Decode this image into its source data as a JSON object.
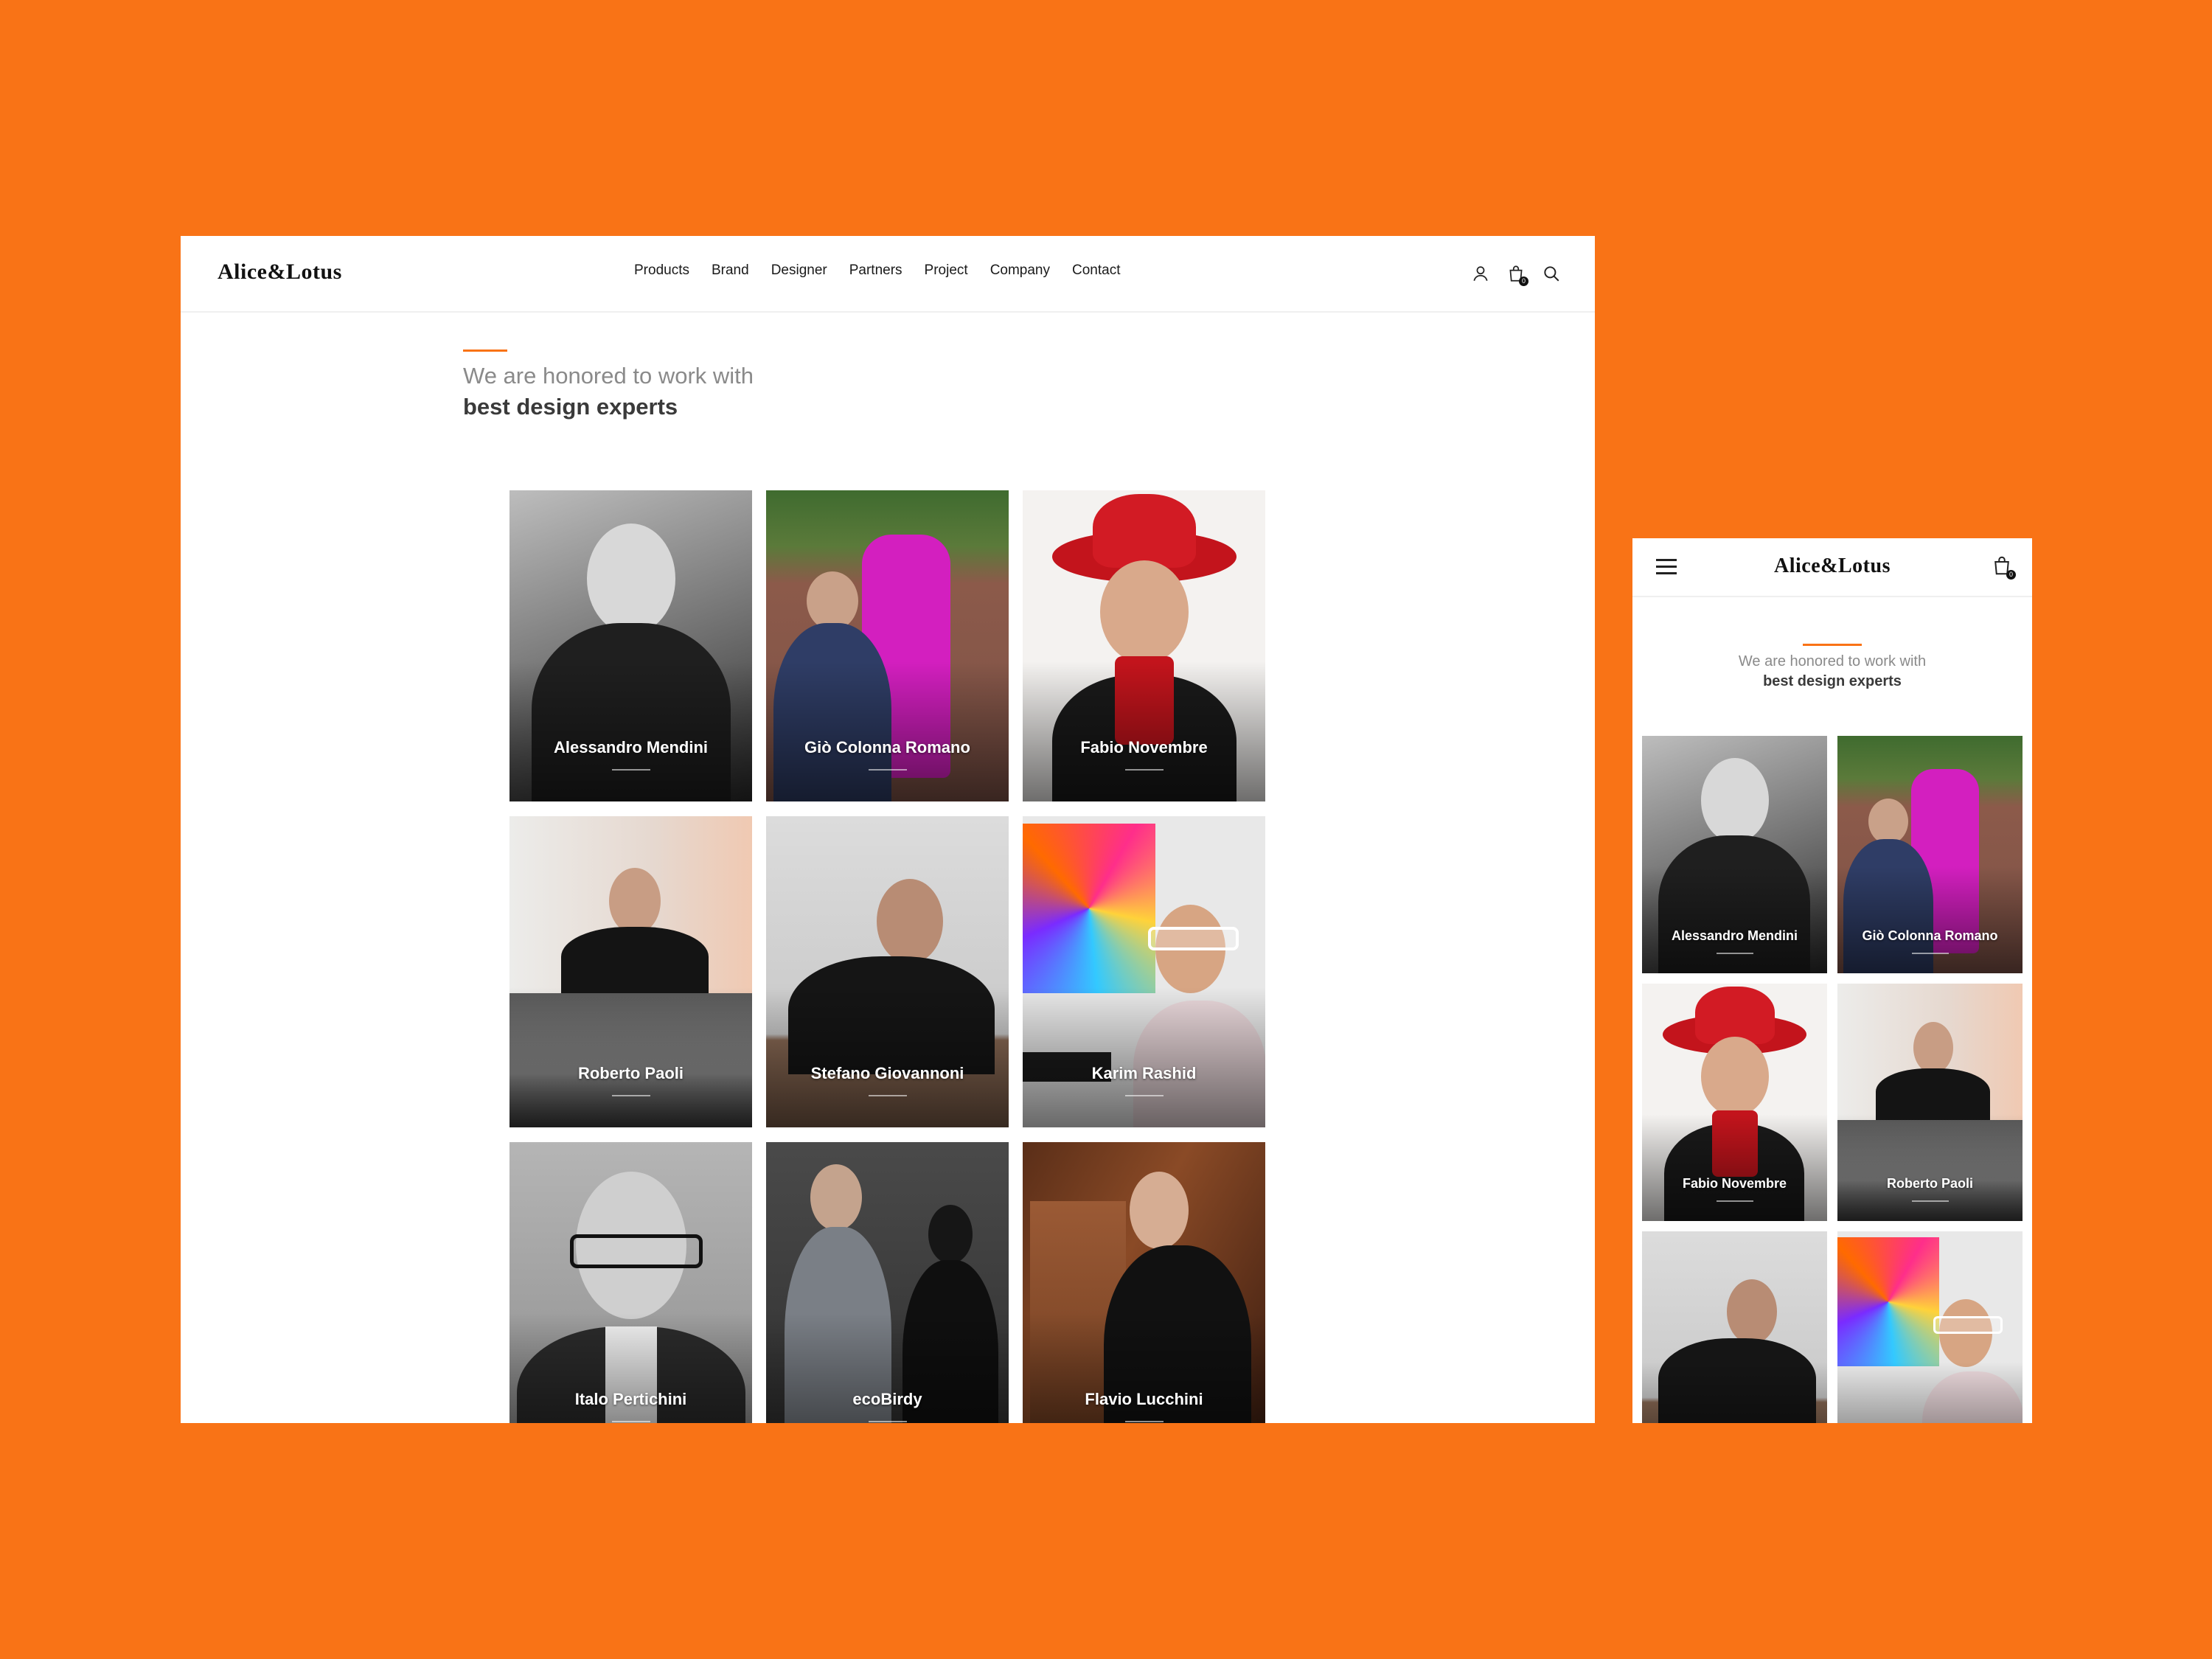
{
  "brand": {
    "name": "Alice&Lotus"
  },
  "nav": [
    "Products",
    "Brand",
    "Designer",
    "Partners",
    "Project",
    "Company",
    "Contact"
  ],
  "cart": {
    "count": "0"
  },
  "intro": {
    "line1": "We are honored to work with",
    "line2": "best design experts"
  },
  "designers": [
    {
      "name": "Alessandro Mendini"
    },
    {
      "name": "Giò Colonna Romano"
    },
    {
      "name": "Fabio Novembre"
    },
    {
      "name": "Roberto Paoli"
    },
    {
      "name": "Stefano Giovannoni"
    },
    {
      "name": "Karim Rashid"
    },
    {
      "name": "Italo Pertichini"
    },
    {
      "name": "ecoBirdy"
    },
    {
      "name": "Flavio Lucchini"
    }
  ],
  "colors": {
    "background": "#F97316",
    "accent": "#F97316",
    "text_dark": "#1a1a1a",
    "text_muted": "#8a8a8a"
  },
  "icons": [
    "user-icon",
    "shopping-bag-icon",
    "search-icon",
    "hamburger-menu-icon"
  ]
}
